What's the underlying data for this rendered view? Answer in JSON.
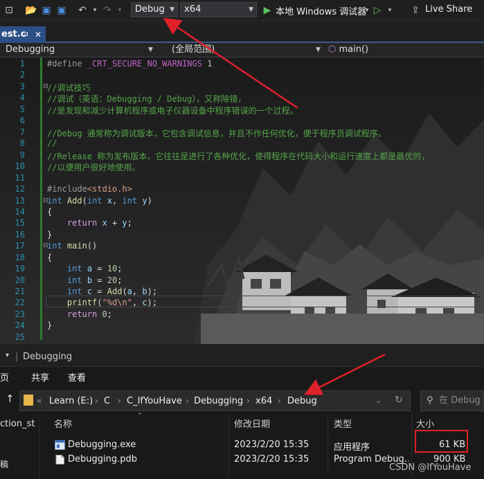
{
  "toolbar": {
    "config": "Debug",
    "platform": "x64",
    "run_label": "本地 Windows 调试器",
    "live_share": "Live Share"
  },
  "tab": {
    "name": "est.c",
    "pin": "⊿",
    "close": "✕"
  },
  "nav": {
    "project": "Debugging",
    "scope": "(全局范围)",
    "member": "main()"
  },
  "editor": {
    "line_numbers": [
      "1",
      "2",
      "3",
      "4",
      "5",
      "6",
      "7",
      "8",
      "9",
      "10",
      "11",
      "12",
      "13",
      "14",
      "15",
      "16",
      "17",
      "18",
      "19",
      "20",
      "21",
      "22",
      "23",
      "24",
      "25"
    ],
    "l1_define": "#define",
    "l1_macro": "_CRT_SECURE_NO_WARNINGS",
    "l1_val": "1",
    "l3": "//调试技巧",
    "l4": "//调试（英语：Debugging / Debug），又称除错，",
    "l5": "//是发现和减少计算机程序或电子仪器设备中程序错误的一个过程。",
    "l7": "//Debug 通常称为调试版本，它包含调试信息，并且不作任何优化，便于程序员调试程序。",
    "l8": "//",
    "l9": "//Release 称为发布版本，它往往是进行了各种优化，使得程序在代码大小和运行速度上都是最优的，",
    "l10": "//以便用户很好地使用。",
    "l12_inc": "#include",
    "l12_hdr": "<stdio.h>",
    "kw_int": "int",
    "kw_return": "return",
    "fn_add": "Add",
    "fn_main": "main",
    "fn_printf": "printf",
    "v_x": "x",
    "v_y": "y",
    "v_a": "a",
    "v_b": "b",
    "v_c": "c",
    "n_10": "10",
    "n_20": "20",
    "n_0": "0",
    "fmt": "\"%d\\n\""
  },
  "explorer": {
    "title": "Debugging",
    "ribbon": [
      "页",
      "共享",
      "查看"
    ],
    "breadcrumb": [
      "Learn (E:)",
      "C",
      "C_IfYouHave",
      "Debugging",
      "x64",
      "Debug"
    ],
    "search_placeholder": "在 Debug",
    "left_items": [
      "ction_st",
      "稿"
    ],
    "columns": {
      "name": "名称",
      "date": "修改日期",
      "type": "类型",
      "size": "大小"
    },
    "files": [
      {
        "name": "Debugging.exe",
        "date": "2023/2/20 15:35",
        "type": "应用程序",
        "size": "61 KB"
      },
      {
        "name": "Debugging.pdb",
        "date": "2023/2/20 15:35",
        "type": "Program Debug...",
        "size": "900 KB"
      }
    ]
  },
  "watermark": "CSDN @IfYouHave",
  "colors": {
    "keyword": "#569cd6",
    "comment": "#57a64a",
    "line_number": "#2b91af",
    "annotation": "#e0212a",
    "tab_active": "#2d4f87"
  }
}
